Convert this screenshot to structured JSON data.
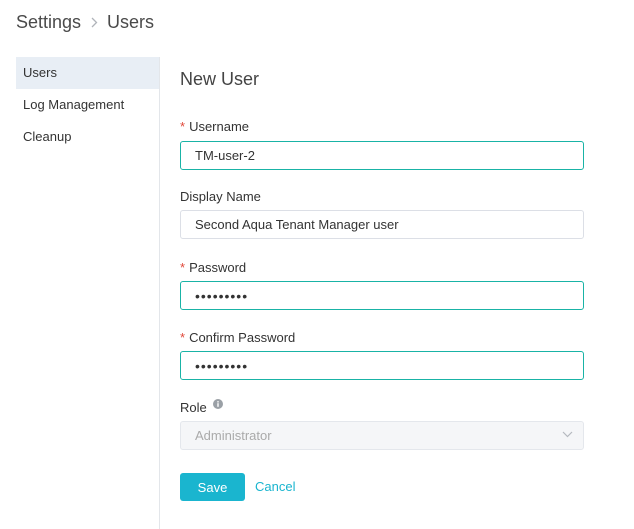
{
  "breadcrumb": {
    "root": "Settings",
    "current": "Users",
    "separator_icon": "chevron-right-icon"
  },
  "sidebar": {
    "items": [
      {
        "label": "Users",
        "active": true
      },
      {
        "label": "Log Management",
        "active": false
      },
      {
        "label": "Cleanup",
        "active": false
      }
    ]
  },
  "form": {
    "title": "New User",
    "username": {
      "label": "Username",
      "required": true,
      "value": "TM-user-2"
    },
    "display_name": {
      "label": "Display Name",
      "required": false,
      "value": "Second Aqua Tenant Manager user"
    },
    "password": {
      "label": "Password",
      "required": true,
      "value": "•••••••••"
    },
    "confirm_password": {
      "label": "Confirm Password",
      "required": true,
      "value": "•••••••••"
    },
    "role": {
      "label": "Role",
      "info_icon": "info-icon",
      "value": "Administrator",
      "disabled": true
    },
    "required_marker": "*",
    "save_label": "Save",
    "cancel_label": "Cancel"
  },
  "colors": {
    "accent": "#1ab5cf",
    "focus_border": "#19b3a6",
    "required": "#e0483a",
    "sidebar_active": "#e8eef5"
  }
}
